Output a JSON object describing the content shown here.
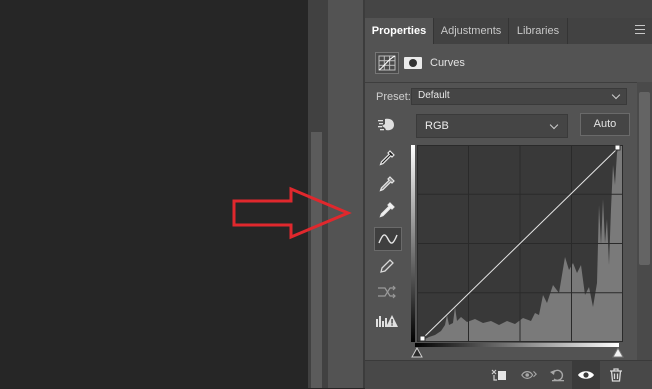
{
  "panel": {
    "tabs": [
      {
        "label": "Properties",
        "active": true
      },
      {
        "label": "Adjustments",
        "active": false
      },
      {
        "label": "Libraries",
        "active": false
      }
    ],
    "menu_icon": "panel-menu-icon",
    "title": "Curves",
    "preset": {
      "label": "Preset:",
      "value": "Default"
    },
    "channel": {
      "value": "RGB"
    },
    "auto_label": "Auto",
    "tools": [
      "on-image-adjust-icon",
      "black-point-eyedropper-icon",
      "gray-point-eyedropper-icon",
      "white-point-eyedropper-icon",
      "curve-points-icon",
      "pencil-draw-icon",
      "smooth-curve-icon",
      "clipping-warning-icon"
    ],
    "bottom_icons": [
      "clip-to-layer-icon",
      "view-previous-state-icon",
      "reset-adjustments-icon",
      "visibility-eye-icon",
      "delete-trash-icon"
    ]
  },
  "colors": {
    "annotation_arrow": "#e0282d",
    "panel_bg": "#535353",
    "canvas_bg": "#262626"
  }
}
